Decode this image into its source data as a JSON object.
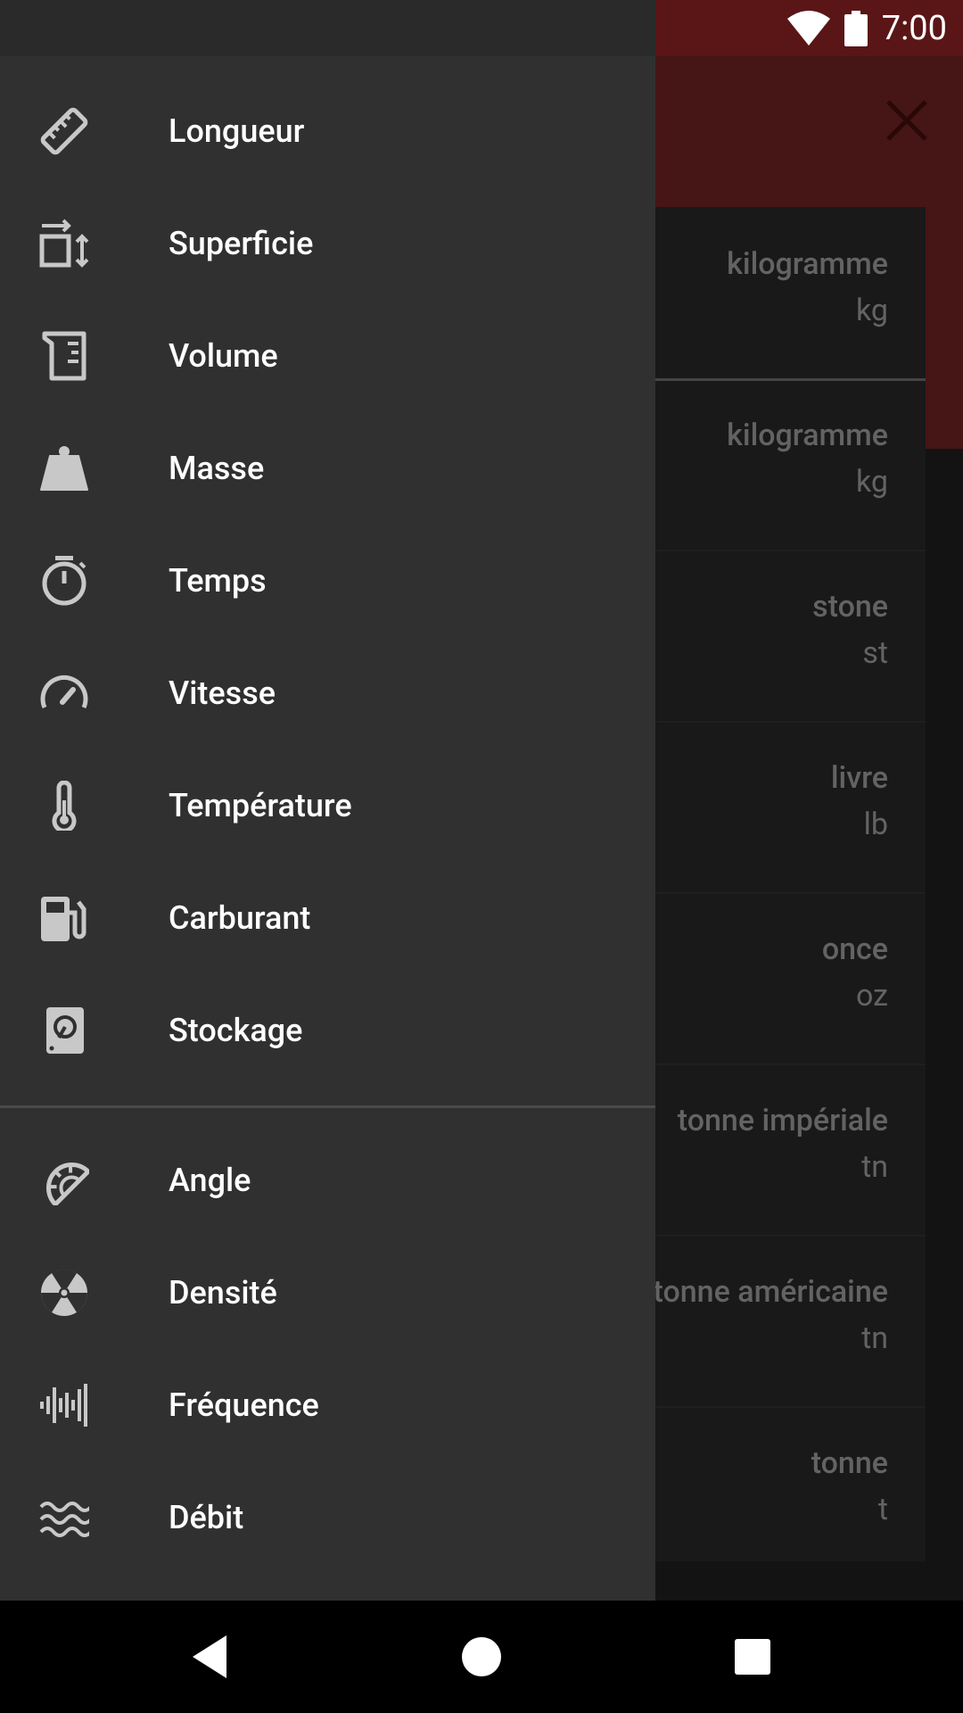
{
  "status_bar": {
    "time": "7:00",
    "icons": [
      "wifi-icon",
      "battery-icon"
    ]
  },
  "header": {
    "close_icon": "close-icon",
    "accent_color": "#621e1e"
  },
  "units": [
    {
      "name": "kilogramme",
      "abbr": "kg",
      "selected": true
    },
    {
      "name": "kilogramme",
      "abbr": "kg"
    },
    {
      "name": "stone",
      "abbr": "st"
    },
    {
      "name": "livre",
      "abbr": "lb"
    },
    {
      "name": "once",
      "abbr": "oz"
    },
    {
      "name": "tonne impériale",
      "abbr": "tn"
    },
    {
      "name": "tonne américaine",
      "abbr": "tn"
    },
    {
      "name": "tonne",
      "abbr": "t"
    }
  ],
  "drawer": {
    "items": [
      {
        "label": "Longueur",
        "icon": "ruler-icon"
      },
      {
        "label": "Superficie",
        "icon": "area-icon"
      },
      {
        "label": "Volume",
        "icon": "beaker-icon"
      },
      {
        "label": "Masse",
        "icon": "weight-icon"
      },
      {
        "label": "Temps",
        "icon": "timer-icon"
      },
      {
        "label": "Vitesse",
        "icon": "speedometer-icon"
      },
      {
        "label": "Température",
        "icon": "thermometer-icon"
      },
      {
        "label": "Carburant",
        "icon": "fuel-pump-icon"
      },
      {
        "label": "Stockage",
        "icon": "hard-disk-icon"
      },
      {
        "label": "Angle",
        "icon": "protractor-icon"
      },
      {
        "label": "Densité",
        "icon": "radiation-icon"
      },
      {
        "label": "Fréquence",
        "icon": "waveform-icon"
      },
      {
        "label": "Débit",
        "icon": "waves-icon"
      }
    ]
  },
  "nav_bar": {
    "buttons": [
      "back-icon",
      "home-icon",
      "recents-icon"
    ]
  }
}
